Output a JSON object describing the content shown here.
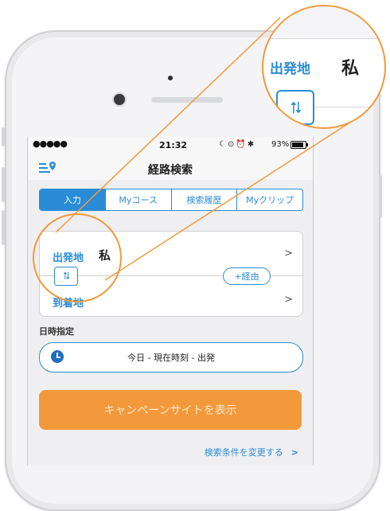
{
  "status_bar": {
    "signal": "●●●●●",
    "time": "21:32",
    "battery": "93%"
  },
  "nav": {
    "title": "経路検索",
    "menu_icon": "location-menu-icon"
  },
  "tabs": [
    {
      "label": "入力"
    },
    {
      "label": "Myコース"
    },
    {
      "label": "検索履歴"
    },
    {
      "label": "Myクリップ"
    }
  ],
  "route": {
    "from_label": "出発地",
    "from_value": "私",
    "to_label": "到着地",
    "via_label": "+経由",
    "swap_glyph": "⮁"
  },
  "datetime": {
    "section_label": "日時指定",
    "value": "今日 - 現在時刻 - 出発"
  },
  "campaign_button": "キャンペーンサイトを表示",
  "conditions_link": "検索条件を変更する",
  "magnifier": {
    "label": "出発地",
    "value": "私"
  },
  "colors": {
    "accent": "#2a8cd6",
    "orange": "#f29a3b"
  }
}
